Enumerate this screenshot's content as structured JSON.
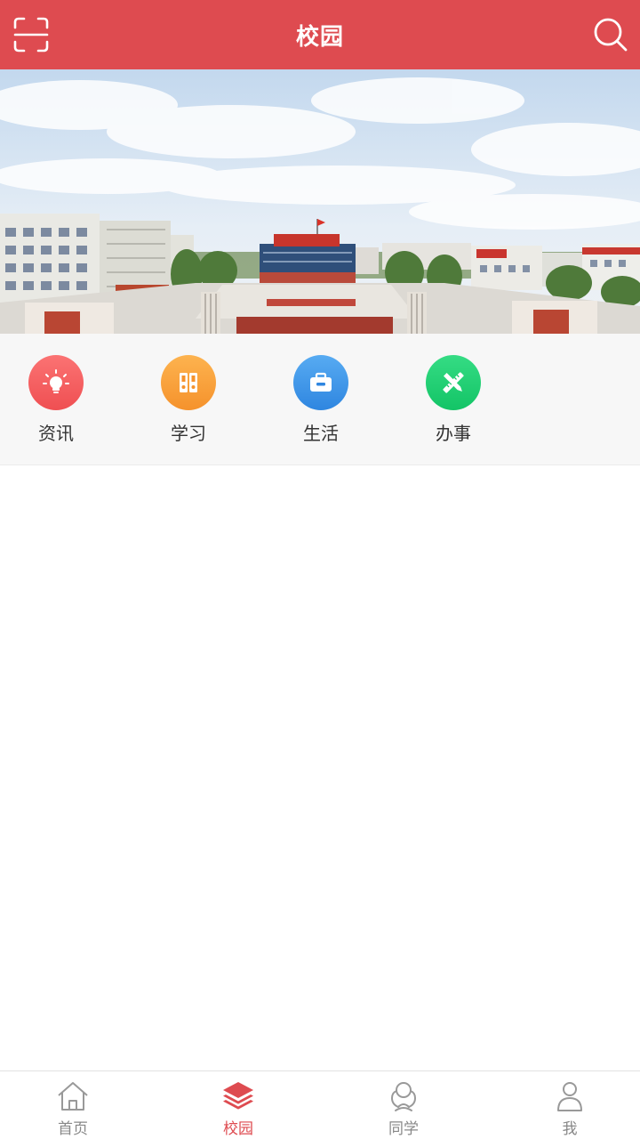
{
  "colors": {
    "brand": "#de4b50",
    "tab_inactive": "#888888",
    "icon_news": "#f35b5b",
    "icon_study": "#f8a13a",
    "icon_life": "#3d97ea",
    "icon_affairs": "#1fcf73"
  },
  "header": {
    "title": "校园",
    "left_icon": "scan-icon",
    "right_icon": "search-icon"
  },
  "banner": {
    "image": "campus-photo"
  },
  "shortcuts": [
    {
      "label": "资讯",
      "icon": "lightbulb-icon"
    },
    {
      "label": "学习",
      "icon": "binders-icon"
    },
    {
      "label": "生活",
      "icon": "briefcase-icon"
    },
    {
      "label": "办事",
      "icon": "pencil-ruler-icon"
    }
  ],
  "tabbar": {
    "active_index": 1,
    "items": [
      {
        "label": "首页",
        "icon": "home-icon"
      },
      {
        "label": "校园",
        "icon": "layers-icon"
      },
      {
        "label": "同学",
        "icon": "classmates-icon"
      },
      {
        "label": "我",
        "icon": "person-icon"
      }
    ]
  }
}
